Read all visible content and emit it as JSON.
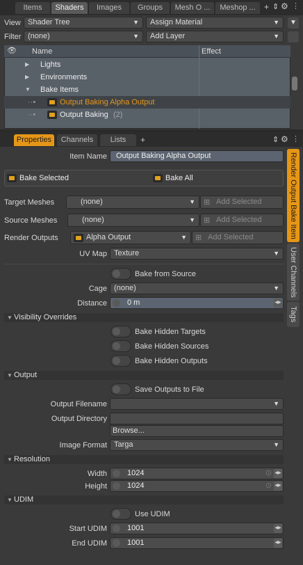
{
  "top_tabs": [
    "Items",
    "Shaders",
    "Images",
    "Groups",
    "Mesh O ...",
    "Meshop ..."
  ],
  "top_tab_plus": "+",
  "view_label": "View",
  "view_value": "Shader Tree",
  "assign_material": "Assign Material",
  "filter_label": "Filter",
  "filter_value": "(none)",
  "add_layer": "Add Layer",
  "tree_headers": {
    "name": "Name",
    "effect": "Effect"
  },
  "tree_rows": [
    {
      "label": "Lights",
      "expander": "▶"
    },
    {
      "label": "Environments",
      "expander": "▶"
    },
    {
      "label": "Bake Items",
      "expander": "▼"
    },
    {
      "label": "Output Baking Alpha Output",
      "selected": true
    },
    {
      "label": "Output Baking",
      "count": "(2)"
    }
  ],
  "bottom_tabs": [
    "Properties",
    "Channels",
    "Lists"
  ],
  "bottom_tab_plus": "+",
  "props": {
    "item_name_label": "Item Name",
    "item_name_value": "Output Baking Alpha Output",
    "bake_selected": "Bake Selected",
    "bake_all": "Bake All",
    "target_meshes_label": "Target Meshes",
    "target_meshes_value": "(none)",
    "source_meshes_label": "Source Meshes",
    "source_meshes_value": "(none)",
    "render_outputs_label": "Render Outputs",
    "render_outputs_value": "Alpha Output",
    "add_selected": "Add Selected",
    "uv_map_label": "UV Map",
    "uv_map_value": "Texture",
    "bake_from_source": "Bake from Source",
    "cage_label": "Cage",
    "cage_value": "(none)",
    "distance_label": "Distance",
    "distance_value": "0 m",
    "visibility_section": "Visibility Overrides",
    "bake_hidden_targets": "Bake Hidden Targets",
    "bake_hidden_sources": "Bake Hidden Sources",
    "bake_hidden_outputs": "Bake Hidden Outputs",
    "output_section": "Output",
    "save_outputs": "Save Outputs to File",
    "output_filename_label": "Output Filename",
    "output_directory_label": "Output Directory",
    "browse": "Browse...",
    "image_format_label": "Image Format",
    "image_format_value": "Targa",
    "resolution_section": "Resolution",
    "width_label": "Width",
    "width_value": "1024",
    "height_label": "Height",
    "height_value": "1024",
    "udim_section": "UDIM",
    "use_udim": "Use UDIM",
    "start_udim_label": "Start UDIM",
    "start_udim_value": "1001",
    "end_udim_label": "End UDIM",
    "end_udim_value": "1001"
  },
  "side_tabs": [
    "Render Output Bake Item",
    "User Channels",
    "Tags"
  ],
  "colors": {
    "accent": "#e69617",
    "selected_text": "#e69617"
  }
}
